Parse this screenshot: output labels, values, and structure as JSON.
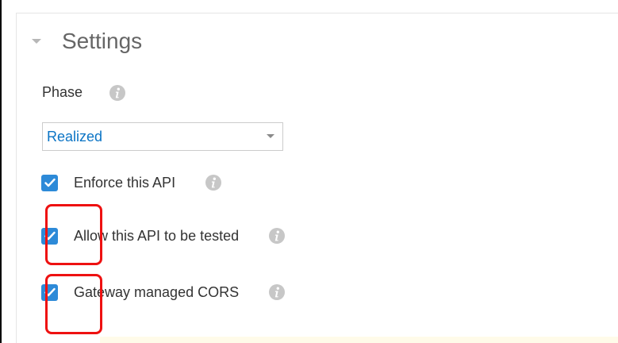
{
  "section": {
    "title": "Settings",
    "chevron_icon": "chevron-down-icon"
  },
  "phase": {
    "label": "Phase",
    "info_icon": "info-icon",
    "selected": "Realized"
  },
  "options": [
    {
      "label": "Enforce this API",
      "checked": true,
      "info_icon": "info-icon"
    },
    {
      "label": "Allow this API to be tested",
      "checked": true,
      "info_icon": "info-icon"
    },
    {
      "label": "Gateway managed CORS",
      "checked": true,
      "info_icon": "info-icon"
    }
  ],
  "colors": {
    "border": "#000000",
    "divider": "#e5e5e5",
    "title": "#666666",
    "text": "#333333",
    "select_text": "#0b74c5",
    "checkbox": "#2d8ad8",
    "info": "#c7c7c7",
    "annotation": "#ee1111",
    "note_background": "#fffbe9"
  }
}
